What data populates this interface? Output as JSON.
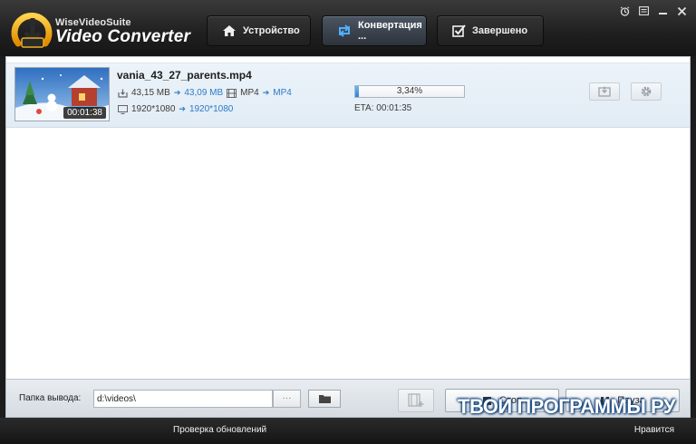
{
  "app": {
    "brand_small": "WiseVideoSuite",
    "brand_big": "Video Converter",
    "accent_color": "#2a7bc8"
  },
  "nav": {
    "tabs": [
      {
        "label": "Устройство",
        "icon": "home-icon",
        "active": false
      },
      {
        "label": "Конвертация ...",
        "icon": "convert-icon",
        "active": true
      },
      {
        "label": "Завершено",
        "icon": "checkbox-icon",
        "active": false
      }
    ]
  },
  "window_controls": [
    "alarm-icon",
    "menu-icon",
    "minimize-icon",
    "close-icon"
  ],
  "file": {
    "name": "vania_43_27_parents.mp4",
    "duration": "00:01:38",
    "size_src": "43,15 MB",
    "size_dst": "43,09 MB",
    "format_src": "MP4",
    "format_dst": "MP4",
    "res_src": "1920*1080",
    "res_dst": "1920*1080",
    "progress_label": "3,34%",
    "progress_value": 3.34,
    "eta": "ETA: 00:01:35"
  },
  "bottom": {
    "output_label": "Папка вывода:",
    "output_path": "d:\\videos\\",
    "browse_label": "···",
    "stop_label": "Стоп",
    "pause_label": "Пауза"
  },
  "status": {
    "update_label": "Проверка обновлений",
    "like_label": "Нравится"
  },
  "watermark": "ТВОИ ПРОГРАММЫ РУ"
}
